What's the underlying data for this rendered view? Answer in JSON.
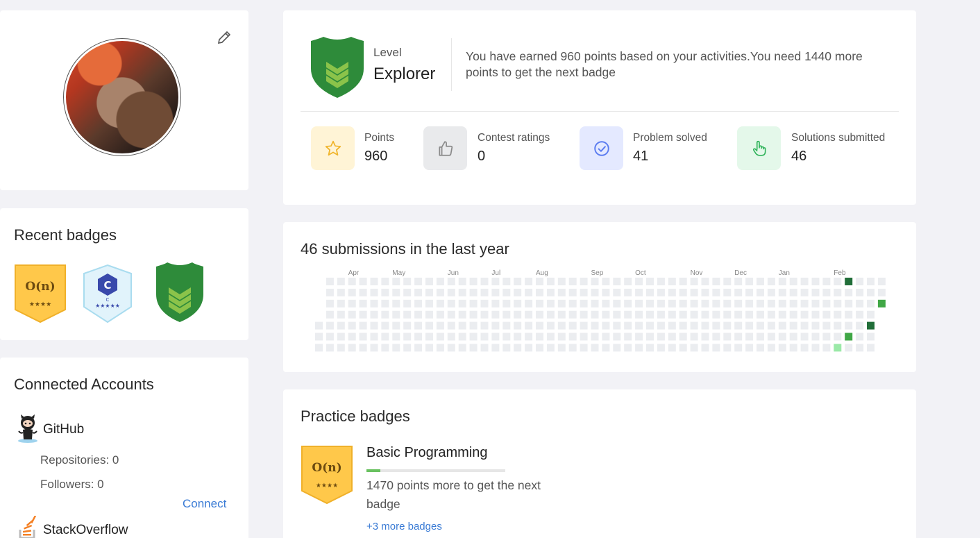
{
  "recent_badges": {
    "title": "Recent badges",
    "items": [
      {
        "name": "on-complexity-badge-icon",
        "text": "O(n)",
        "stars": "★★★★"
      },
      {
        "name": "c-language-badge-icon",
        "text": "C",
        "stars": "★★★★★"
      },
      {
        "name": "explorer-level-badge-icon"
      }
    ]
  },
  "accounts": {
    "title": "Connected Accounts",
    "github": {
      "name": "GitHub",
      "repositories": "Repositories: 0",
      "followers": "Followers: 0",
      "connect": "Connect"
    },
    "stackoverflow": {
      "name": "StackOverflow"
    }
  },
  "level": {
    "label": "Level",
    "name": "Explorer",
    "message": "You have earned 960 points based on your activities.You need 1440 more points to get the next badge"
  },
  "stats": [
    {
      "label": "Points",
      "value": "960",
      "icon": "star-icon",
      "bg": "#fff4d6",
      "color": "#f0b429"
    },
    {
      "label": "Contest ratings",
      "value": "0",
      "icon": "thumbs-up-icon",
      "bg": "#e9eaec",
      "color": "#8a8a8a"
    },
    {
      "label": "Problem solved",
      "value": "41",
      "icon": "check-circle-icon",
      "bg": "#e4e9ff",
      "color": "#5b7cf0"
    },
    {
      "label": "Solutions submitted",
      "value": "46",
      "icon": "pointer-hand-icon",
      "bg": "#e4f8ea",
      "color": "#2fb35a"
    }
  ],
  "submissions": {
    "title": "46 submissions in the last year",
    "months": [
      "Apr",
      "May",
      "Jun",
      "Jul",
      "Aug",
      "Sep",
      "Oct",
      "Nov",
      "Dec",
      "Jan",
      "Feb"
    ]
  },
  "practice": {
    "title": "Practice badges",
    "badge_name": "Basic Programming",
    "progress": 0.1,
    "message": "1470 points more to get the next badge",
    "more": "+3 more badges",
    "badge_text": "O(n)",
    "badge_stars": "★★★★"
  },
  "colors": {
    "accent_blue": "#3a7bd5",
    "badge_green": "#2e8b3a",
    "badge_gold": "#ffc84a",
    "heat_empty": "#ebedf0",
    "heat_level1": "#9be9a8",
    "heat_level2": "#40a746",
    "heat_level3": "#216e39"
  }
}
